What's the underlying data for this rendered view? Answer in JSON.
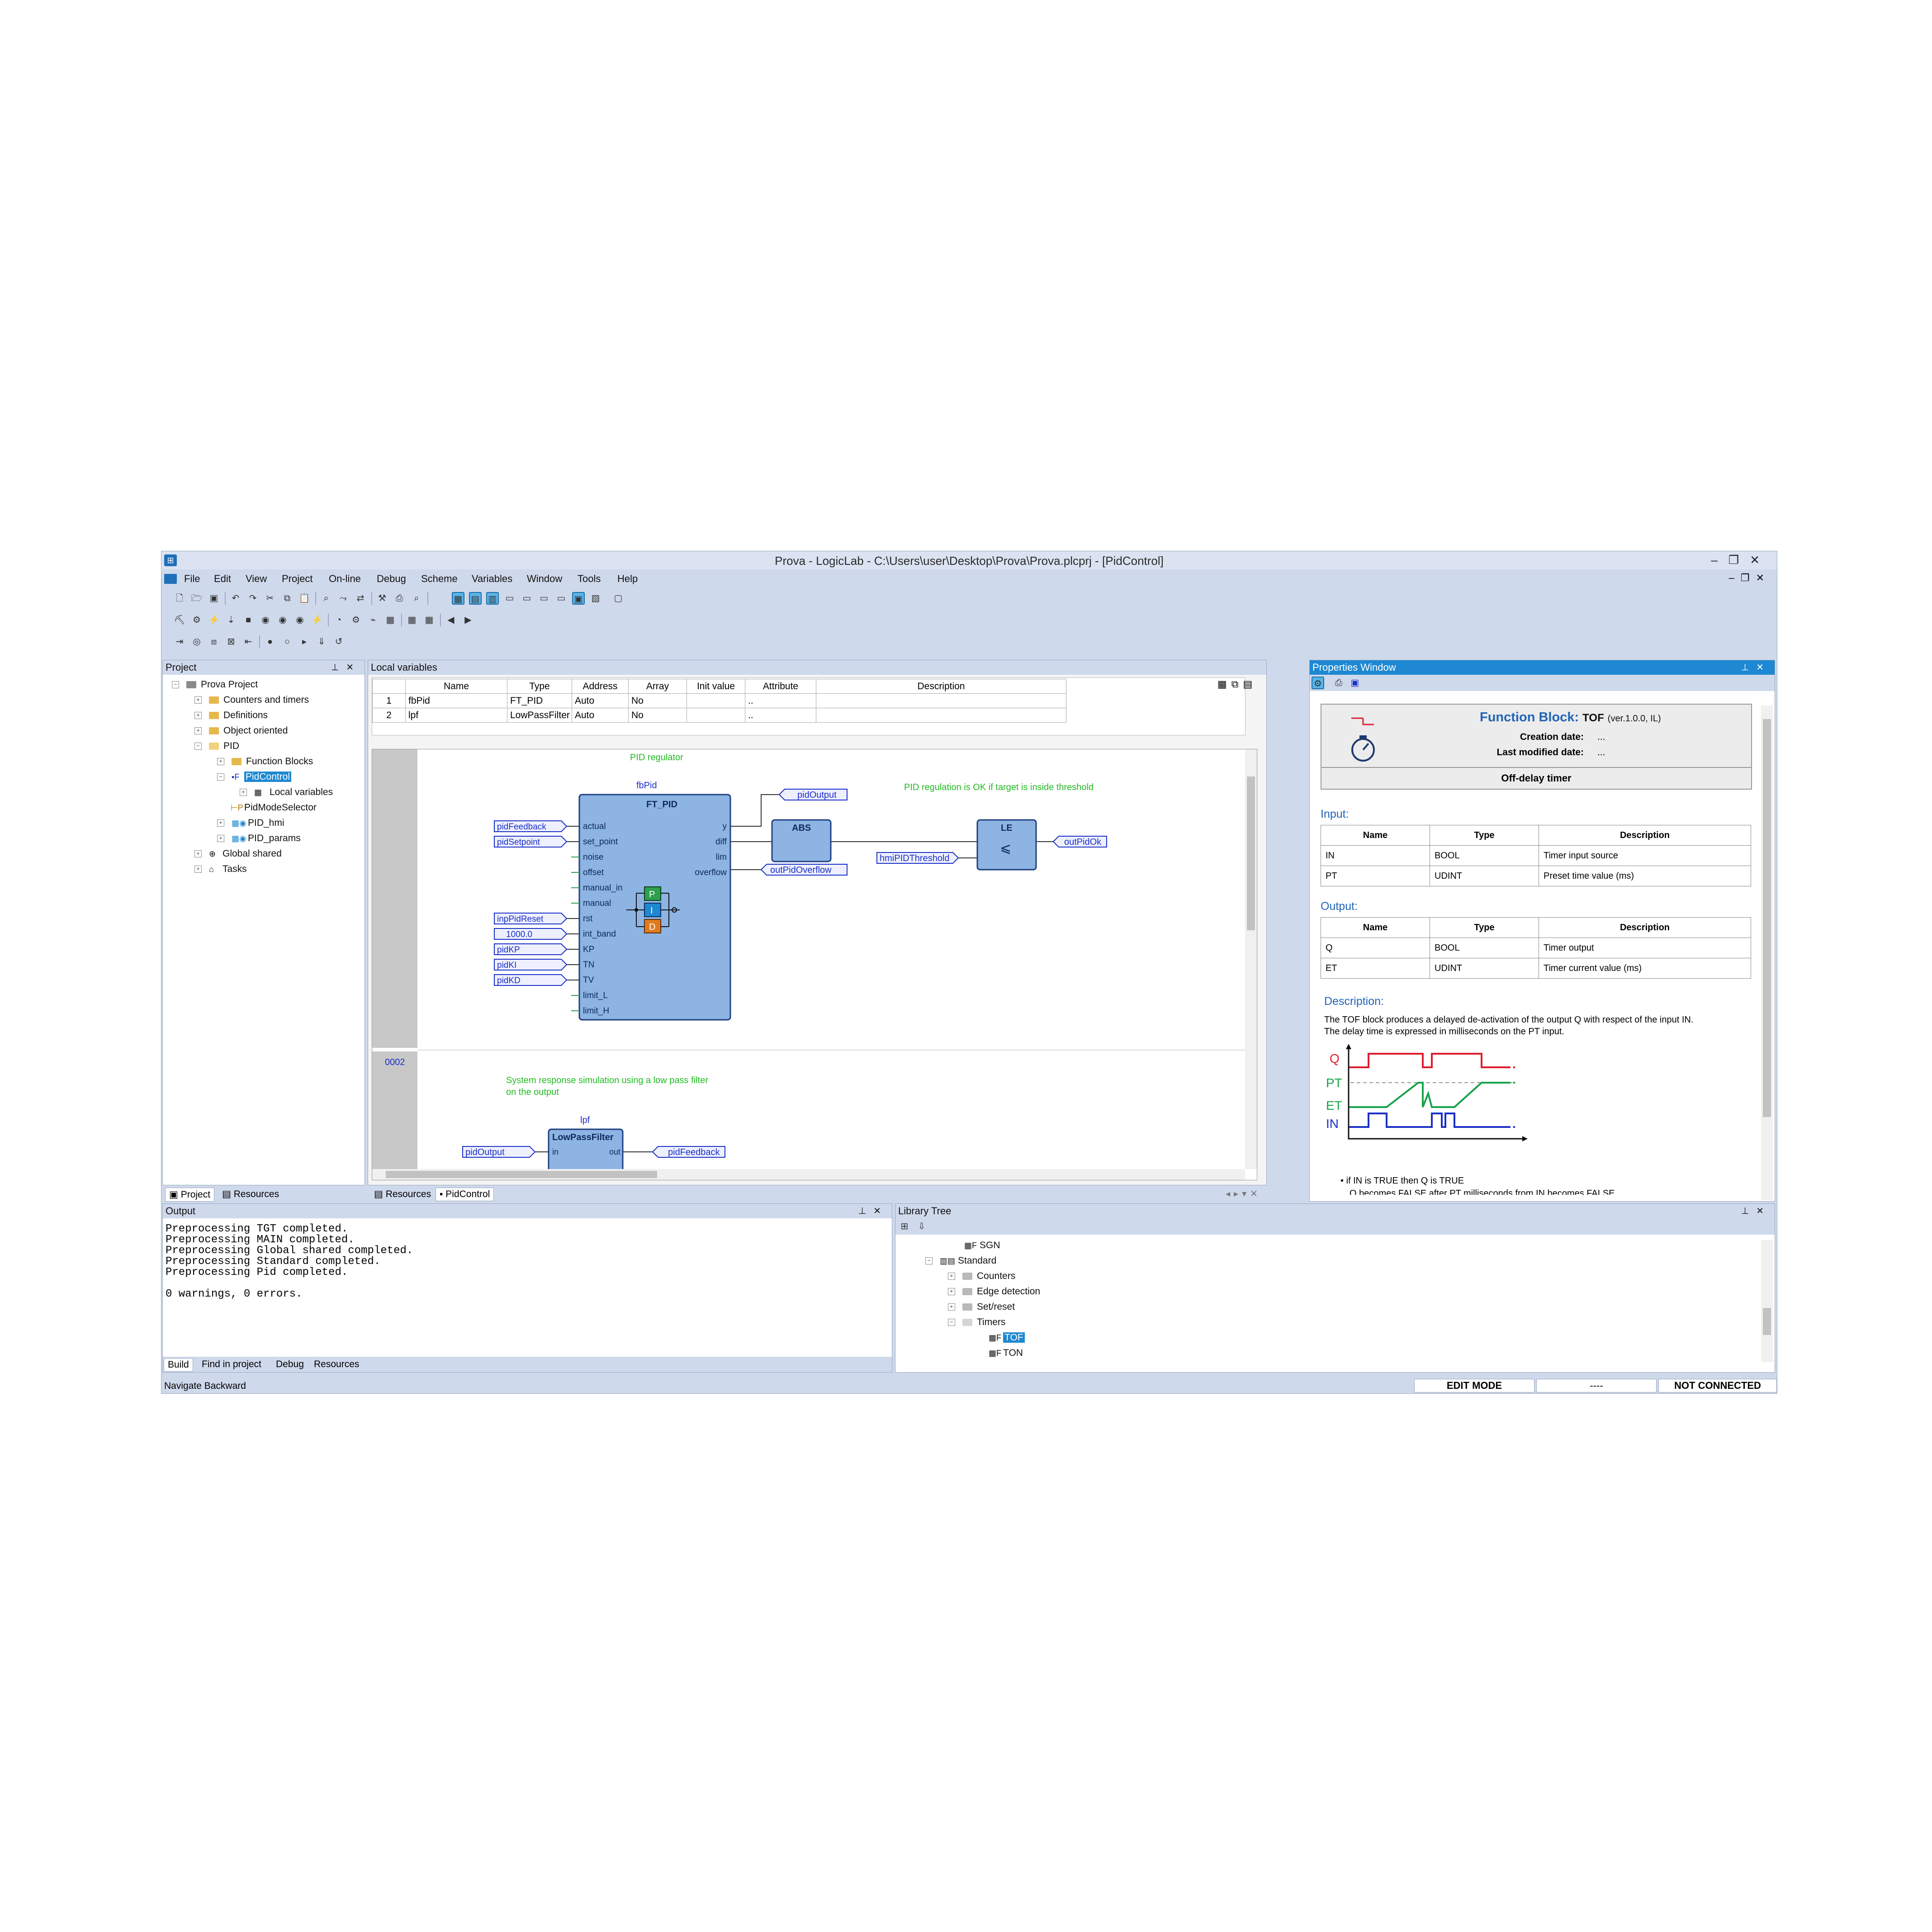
{
  "window": {
    "title": "Prova - LogicLab - C:\\Users\\user\\Desktop\\Prova\\Prova.plcprj - [PidControl]"
  },
  "menu": [
    "File",
    "Edit",
    "View",
    "Project",
    "On-line",
    "Debug",
    "Scheme",
    "Variables",
    "Window",
    "Tools",
    "Help"
  ],
  "project_panel": {
    "title": "Project",
    "items": [
      "Prova Project",
      "Counters and timers",
      "Definitions",
      "Object oriented",
      "PID",
      "Function Blocks",
      "PidControl",
      "Local variables",
      "PidModeSelector",
      "PID_hmi",
      "PID_params",
      "Global shared",
      "Tasks"
    ],
    "tabs": [
      "Project",
      "Resources"
    ]
  },
  "local_vars": {
    "title": "Local variables",
    "columns": [
      "",
      "Name",
      "Type",
      "Address",
      "Array",
      "Init value",
      "Attribute",
      "Description"
    ],
    "rows": [
      [
        "1",
        "fbPid",
        "FT_PID",
        "Auto",
        "No",
        "",
        "..",
        ""
      ],
      [
        "2",
        "lpf",
        "LowPassFilter",
        "Auto",
        "No",
        "",
        "..",
        ""
      ]
    ]
  },
  "diagram": {
    "net1_comment": "PID regulator",
    "net1_ok_comment": "PID regulation is OK if target is inside threshold",
    "fb_instance": "fbPid",
    "fb_type": "FT_PID",
    "fb_inputs": [
      "actual",
      "set_point",
      "noise",
      "offset",
      "manual_in",
      "manual",
      "rst",
      "int_band",
      "KP",
      "TN",
      "TV",
      "limit_L",
      "limit_H"
    ],
    "fb_outputs": [
      "y",
      "diff",
      "lim",
      "overflow"
    ],
    "in_vars": [
      "pidFeedback",
      "pidSetpoint",
      "inpPidReset",
      "1000.0",
      "pidKP",
      "pidKI",
      "pidKD"
    ],
    "out_var_y": "pidOutput",
    "out_var_overflow": "outPidOverflow",
    "abs_label": "ABS",
    "le_label": "LE",
    "le_symbol": "⩽",
    "threshold_var": "hmiPIDThreshold",
    "ok_var": "outPidOk",
    "pid_p": "P",
    "pid_i": "I",
    "pid_d": "D",
    "net2_num": "0002",
    "net2_comment1": "System response simulation using a low pass filter",
    "net2_comment2": "on the output",
    "lpf_instance": "lpf",
    "lpf_type": "LowPassFilter",
    "lpf_in": "in",
    "lpf_out": "out",
    "lpf_in_var": "pidOutput",
    "lpf_out_var": "pidFeedback"
  },
  "editor_tabs": [
    "Resources",
    "PidControl"
  ],
  "properties": {
    "title": "Properties Window",
    "fb_label": "Function Block:",
    "fb_name": "TOF",
    "fb_ver": "(ver.1.0.0, IL)",
    "creation_label": "Creation date:",
    "creation_val": "...",
    "modified_label": "Last modified date:",
    "modified_val": "...",
    "summary": "Off-delay timer",
    "input_label": "Input:",
    "output_label": "Output:",
    "cols": [
      "Name",
      "Type",
      "Description"
    ],
    "inputs": [
      [
        "IN",
        "BOOL",
        "Timer input source"
      ],
      [
        "PT",
        "UDINT",
        "Preset time value (ms)"
      ]
    ],
    "outputs": [
      [
        "Q",
        "BOOL",
        "Timer output"
      ],
      [
        "ET",
        "UDINT",
        "Timer current value (ms)"
      ]
    ],
    "desc_label": "Description:",
    "desc1": "The TOF block produces a delayed de-activation of the output Q with respect of the input IN.",
    "desc2": "The delay time is expressed in milliseconds on the PT input.",
    "chart_labels": [
      "Q",
      "PT",
      "ET",
      "IN"
    ],
    "bullet1": "if IN is TRUE then Q is TRUE",
    "bullet2": "Q becomes FALSE after PT milliseconds from IN becomes FALSE"
  },
  "output": {
    "title": "Output",
    "lines": [
      "Preprocessing TGT completed.",
      "Preprocessing MAIN completed.",
      "Preprocessing Global shared completed.",
      "Preprocessing Standard completed.",
      "Preprocessing Pid completed.",
      "",
      "0 warnings, 0 errors."
    ],
    "tabs": [
      "Build",
      "Find in project",
      "Debug",
      "Resources"
    ]
  },
  "library": {
    "title": "Library Tree",
    "items": [
      "SGN",
      "Standard",
      "Counters",
      "Edge detection",
      "Set/reset",
      "Timers",
      "TOF",
      "TON"
    ]
  },
  "status": {
    "left": "Navigate Backward",
    "mode": "EDIT MODE",
    "mid": "----",
    "conn": "NOT CONNECTED"
  },
  "colors": {
    "accent": "#1e88d2",
    "fb_fill": "#8db4e2",
    "comment": "#22bb22",
    "q": "#dd1f2f",
    "pt": "#17a34a",
    "in": "#1a2fc7"
  }
}
